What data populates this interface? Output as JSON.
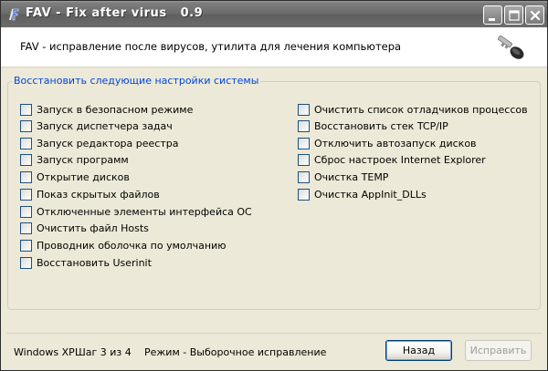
{
  "window": {
    "title": "FAV - Fix after virus   0.9"
  },
  "header": {
    "description": "FAV - исправление после вирусов, утилита для лечения компьютера"
  },
  "group": {
    "title": "Восстановить следующие настройки системы",
    "left_options": [
      {
        "label": "Запуск в безопасном режиме",
        "checked": false
      },
      {
        "label": "Запуск диспетчера задач",
        "checked": false
      },
      {
        "label": "Запуск редактора реестра",
        "checked": false
      },
      {
        "label": "Запуск программ",
        "checked": false
      },
      {
        "label": "Открытие дисков",
        "checked": false
      },
      {
        "label": "Показ скрытых файлов",
        "checked": false
      },
      {
        "label": "Отключенные элементы интерфейса ОС",
        "checked": false
      },
      {
        "label": "Очистить файл Hosts",
        "checked": false
      },
      {
        "label": "Проводник оболочка по умолчанию",
        "checked": false
      },
      {
        "label": "Восстановить Userinit",
        "checked": false
      }
    ],
    "right_options": [
      {
        "label": "Очистить список отладчиков процессов",
        "checked": false
      },
      {
        "label": "Восстановить стек TCP/IP",
        "checked": false
      },
      {
        "label": "Отключить автозапуск дисков",
        "checked": false
      },
      {
        "label": "Сброс настроек Internet Explorer",
        "checked": false
      },
      {
        "label": "Очистка TEMP",
        "checked": false
      },
      {
        "label": "Очистка AppInit_DLLs",
        "checked": false
      }
    ]
  },
  "footer": {
    "os": "Windows XP",
    "step": "Шаг 3 из 4",
    "mode": "Режим - Выборочное исправление",
    "back_label": "Назад",
    "fix_label": "Исправить",
    "fix_enabled": false
  }
}
